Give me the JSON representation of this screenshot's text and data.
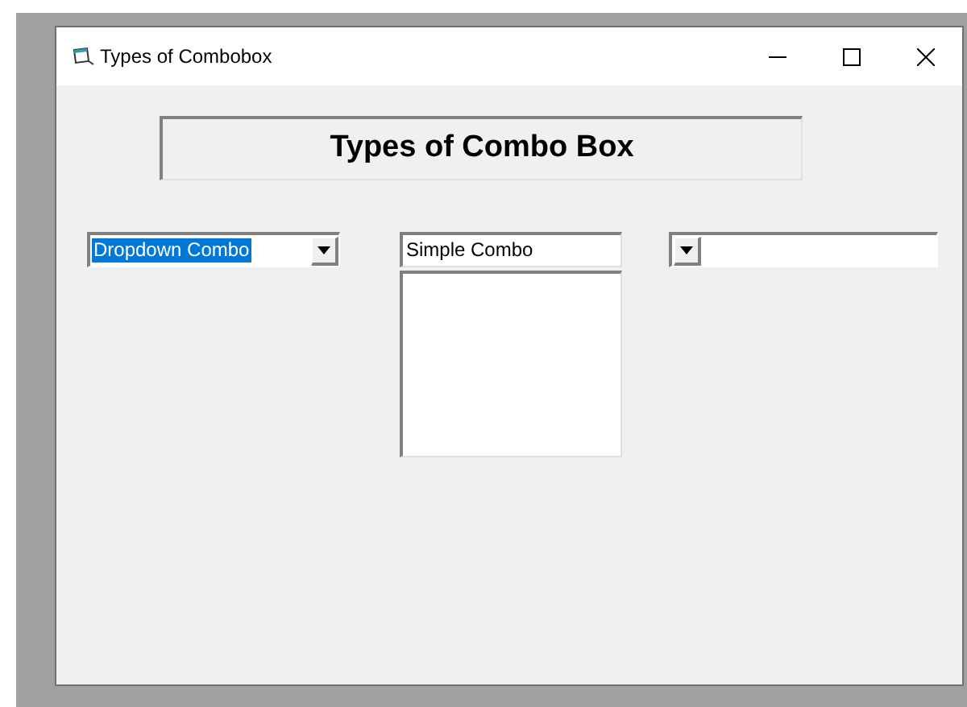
{
  "window": {
    "title": "Types of Combobox"
  },
  "heading": "Types of Combo Box",
  "combos": [
    {
      "kind": "dropdown",
      "value": "Dropdown Combo",
      "text_selected": true
    },
    {
      "kind": "simple",
      "value": "Simple Combo",
      "text_selected": false
    },
    {
      "kind": "dropdown_list"
    }
  ]
}
